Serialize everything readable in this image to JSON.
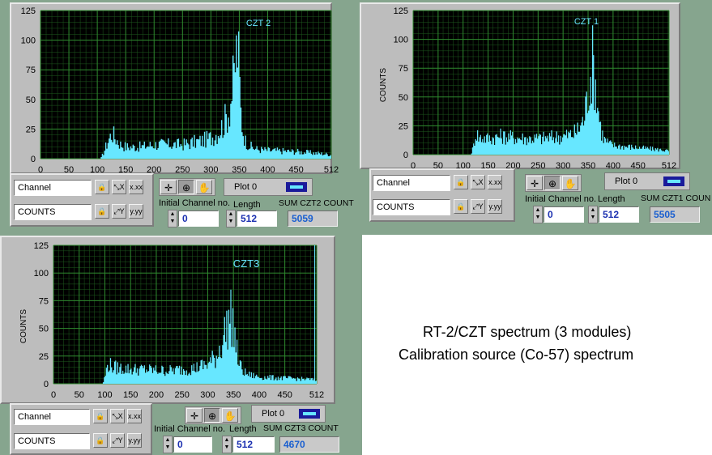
{
  "caption": {
    "line1": "RT-2/CZT spectrum (3 modules)",
    "line2": "Calibration source (Co-57) spectrum"
  },
  "colors": {
    "plot_bg": "#000000",
    "grid": "#2f8a2f",
    "trace": "#67e7ff",
    "panel": "#bdbdbd",
    "background": "#86a58e"
  },
  "icons": [
    "lock-icon",
    "x-autoscale-icon",
    "x-format-icon",
    "y-autoscale-icon",
    "y-format-icon",
    "crosshair-icon",
    "zoom-icon",
    "pan-icon",
    "legend-swatch-icon",
    "spin-up-icon",
    "spin-down-icon"
  ],
  "panels": [
    {
      "id": "czt2",
      "plot_label": "CZT 2",
      "y_axis_label": "",
      "x_scale_name": "Channel",
      "y_scale_name": "COUNTS",
      "legend_label": "Plot 0",
      "initial_label": "Initial Channel no.",
      "initial_value": "0",
      "length_label": "Length",
      "length_value": "512",
      "sum_label": "SUM  CZT2 COUNT",
      "sum_value": "5059",
      "x_ticks": [
        "0",
        "50",
        "100",
        "150",
        "200",
        "250",
        "300",
        "350",
        "400",
        "450",
        "512"
      ],
      "y_ticks": [
        "0",
        "25",
        "50",
        "75",
        "100",
        "125"
      ]
    },
    {
      "id": "czt1",
      "plot_label": "CZT 1",
      "y_axis_label": "COUNTS",
      "x_scale_name": "Channel",
      "y_scale_name": "COUNTS",
      "legend_label": "Plot 0",
      "initial_label": "Initial Channel no.",
      "initial_value": "0",
      "length_label": "Length",
      "length_value": "512",
      "sum_label": "SUM  CZT1 COUN",
      "sum_value": "5505",
      "x_ticks": [
        "0",
        "50",
        "100",
        "150",
        "200",
        "250",
        "300",
        "350",
        "400",
        "450",
        "512"
      ],
      "y_ticks": [
        "0",
        "25",
        "50",
        "75",
        "100",
        "125"
      ]
    },
    {
      "id": "czt3",
      "plot_label": "CZT3",
      "y_axis_label": "COUNTS",
      "x_scale_name": "Channel",
      "y_scale_name": "COUNTS",
      "legend_label": "Plot 0",
      "initial_label": "Initial Channel no.",
      "initial_value": "0",
      "length_label": "Length",
      "length_value": "512",
      "sum_label": "SUM  CZT3 COUNT",
      "sum_value": "4670",
      "x_ticks": [
        "0",
        "50",
        "100",
        "150",
        "200",
        "250",
        "300",
        "350",
        "400",
        "450",
        "512"
      ],
      "y_ticks": [
        "0",
        "25",
        "50",
        "75",
        "100",
        "125"
      ]
    }
  ],
  "chart_data": [
    {
      "type": "area",
      "panel": "czt2",
      "title": "CZT 2",
      "xlabel": "",
      "ylabel": "",
      "xlim": [
        0,
        512
      ],
      "ylim": [
        0,
        125
      ],
      "grid": true,
      "x_ticks": [
        0,
        50,
        100,
        150,
        200,
        250,
        300,
        350,
        400,
        450,
        512
      ],
      "y_ticks": [
        0,
        25,
        50,
        75,
        100,
        125
      ],
      "series": [
        {
          "x": [
            0,
            105,
            110,
            118,
            125,
            130,
            140,
            150,
            175,
            200,
            225,
            250,
            270,
            290,
            300,
            310,
            320,
            330,
            335,
            340,
            343,
            346,
            348,
            350,
            352,
            355,
            360,
            370,
            380,
            400,
            450,
            500,
            512
          ],
          "y": [
            0,
            0,
            5,
            15,
            22,
            18,
            12,
            10,
            10,
            12,
            12,
            12,
            14,
            16,
            18,
            22,
            28,
            40,
            52,
            68,
            86,
            95,
            80,
            60,
            40,
            25,
            15,
            10,
            8,
            7,
            6,
            4,
            3
          ]
        }
      ]
    },
    {
      "type": "area",
      "panel": "czt1",
      "title": "CZT 1",
      "xlabel": "",
      "ylabel": "COUNTS",
      "xlim": [
        0,
        512
      ],
      "ylim": [
        0,
        125
      ],
      "grid": true,
      "x_ticks": [
        0,
        50,
        100,
        150,
        200,
        250,
        300,
        350,
        400,
        450,
        512
      ],
      "y_ticks": [
        0,
        25,
        50,
        75,
        100,
        125
      ],
      "series": [
        {
          "x": [
            0,
            115,
            120,
            125,
            130,
            150,
            175,
            200,
            225,
            250,
            275,
            300,
            320,
            330,
            340,
            345,
            350,
            355,
            358,
            362,
            365,
            370,
            375,
            380,
            390,
            400,
            450,
            500,
            512
          ],
          "y": [
            0,
            0,
            8,
            20,
            15,
            14,
            16,
            15,
            14,
            14,
            15,
            16,
            18,
            22,
            30,
            42,
            58,
            72,
            80,
            70,
            55,
            38,
            22,
            14,
            10,
            8,
            6,
            4,
            3
          ]
        }
      ]
    },
    {
      "type": "area",
      "panel": "czt3",
      "title": "CZT3",
      "xlabel": "",
      "ylabel": "COUNTS",
      "xlim": [
        0,
        512
      ],
      "ylim": [
        0,
        125
      ],
      "grid": true,
      "x_ticks": [
        0,
        50,
        100,
        150,
        200,
        250,
        300,
        350,
        400,
        450,
        512
      ],
      "y_ticks": [
        0,
        25,
        50,
        75,
        100,
        125
      ],
      "series": [
        {
          "x": [
            0,
            95,
            100,
            105,
            115,
            130,
            150,
            175,
            200,
            225,
            250,
            275,
            300,
            315,
            325,
            335,
            340,
            345,
            348,
            352,
            356,
            360,
            370,
            380,
            400,
            450,
            500,
            510,
            512
          ],
          "y": [
            0,
            0,
            8,
            18,
            15,
            14,
            13,
            13,
            12,
            12,
            13,
            14,
            18,
            24,
            35,
            50,
            58,
            60,
            55,
            42,
            28,
            18,
            10,
            8,
            6,
            5,
            4,
            3,
            3
          ]
        }
      ]
    }
  ]
}
